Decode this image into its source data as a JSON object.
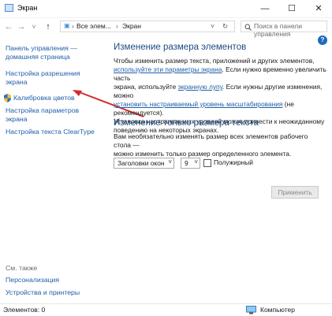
{
  "window": {
    "title": "Экран",
    "minimize_glyph": "—",
    "maximize_glyph": "☐",
    "close_glyph": "✕"
  },
  "nav": {
    "back_glyph": "←",
    "forward_glyph": "→",
    "recent_glyph": "˅",
    "up_glyph": "↑",
    "breadcrumb": [
      "Все элем...",
      "Экран"
    ],
    "separator": "›",
    "dropdown_glyph": "˅",
    "refresh_glyph": "↻",
    "search_placeholder": "Поиск в панели управления"
  },
  "sidebar": {
    "home_link_line1": "Панель управления —",
    "home_link_line2": "домашняя страница",
    "items": [
      {
        "line1": "Настройка разрешения",
        "line2": "экрана"
      },
      {
        "line1": "Калибровка цветов",
        "line2": ""
      },
      {
        "line1": "Настройка параметров",
        "line2": "экрана"
      },
      {
        "line1": "Настройка текста ClearType",
        "line2": ""
      }
    ],
    "see_also": "См. также",
    "bottom_links": [
      "Персонализация",
      "Устройства и принтеры"
    ]
  },
  "main": {
    "section1_title": "Изменение размера элементов",
    "p1_line1": "Чтобы изменить размер текста, приложений и других элементов,",
    "p1_link": "используйте эти параметры экрана",
    "p1_line2_rest": ". Если нужно временно увеличить часть",
    "p1_line3_start": "экрана, используйте",
    "p1_link2": "экранную лупу",
    "p1_line3_rest": ". Если нужны другие изменения, можно",
    "p1_link3": "установить настраиваемый уровень масштабирования",
    "p1_line4_rest": " (не рекомендуется).",
    "p1_line5": "Установка настраиваемых уровней может привести к неожиданному",
    "p1_line6": "поведению на некоторых экранах.",
    "section2_title": "Изменение только размера текста",
    "p2_line1": "Вам необязательно изменять размер всех элементов рабочего стола —",
    "p2_line2": "можно изменить только размер определенного элемента.",
    "element_select": "Заголовки окон",
    "size_select": "9",
    "bold_label": "Полужирный",
    "apply_button": "Применить",
    "help_glyph": "?"
  },
  "status": {
    "left": "Элементов: 0",
    "right": "Компьютер"
  },
  "colors": {
    "link": "#1f5fa8",
    "heading": "#1e4b80",
    "annotation_arrow": "#d62a2a"
  },
  "icons": [
    "window-icon",
    "shield-icon",
    "computer-icon",
    "search-icon",
    "help-icon"
  ]
}
